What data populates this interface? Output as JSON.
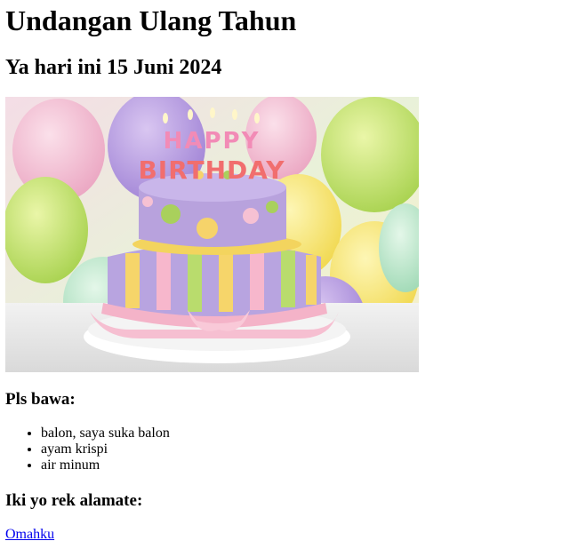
{
  "page": {
    "title": "Undangan Ulang Tahun",
    "subtitle": "Ya hari ini 15 Juni 2024",
    "image": {
      "description": "birthday cake with balloons",
      "cake_text": "HAPPY BIRTHDAY"
    },
    "bring_heading": "Pls bawa:",
    "bring_items": [
      "balon, saya suka balon",
      "ayam krispi",
      "air minum"
    ],
    "address_heading": "Iki yo rek alamate:",
    "address_link": "Omahku"
  },
  "colors": {
    "link": "#0000ee",
    "text": "#000000",
    "background": "#ffffff"
  }
}
